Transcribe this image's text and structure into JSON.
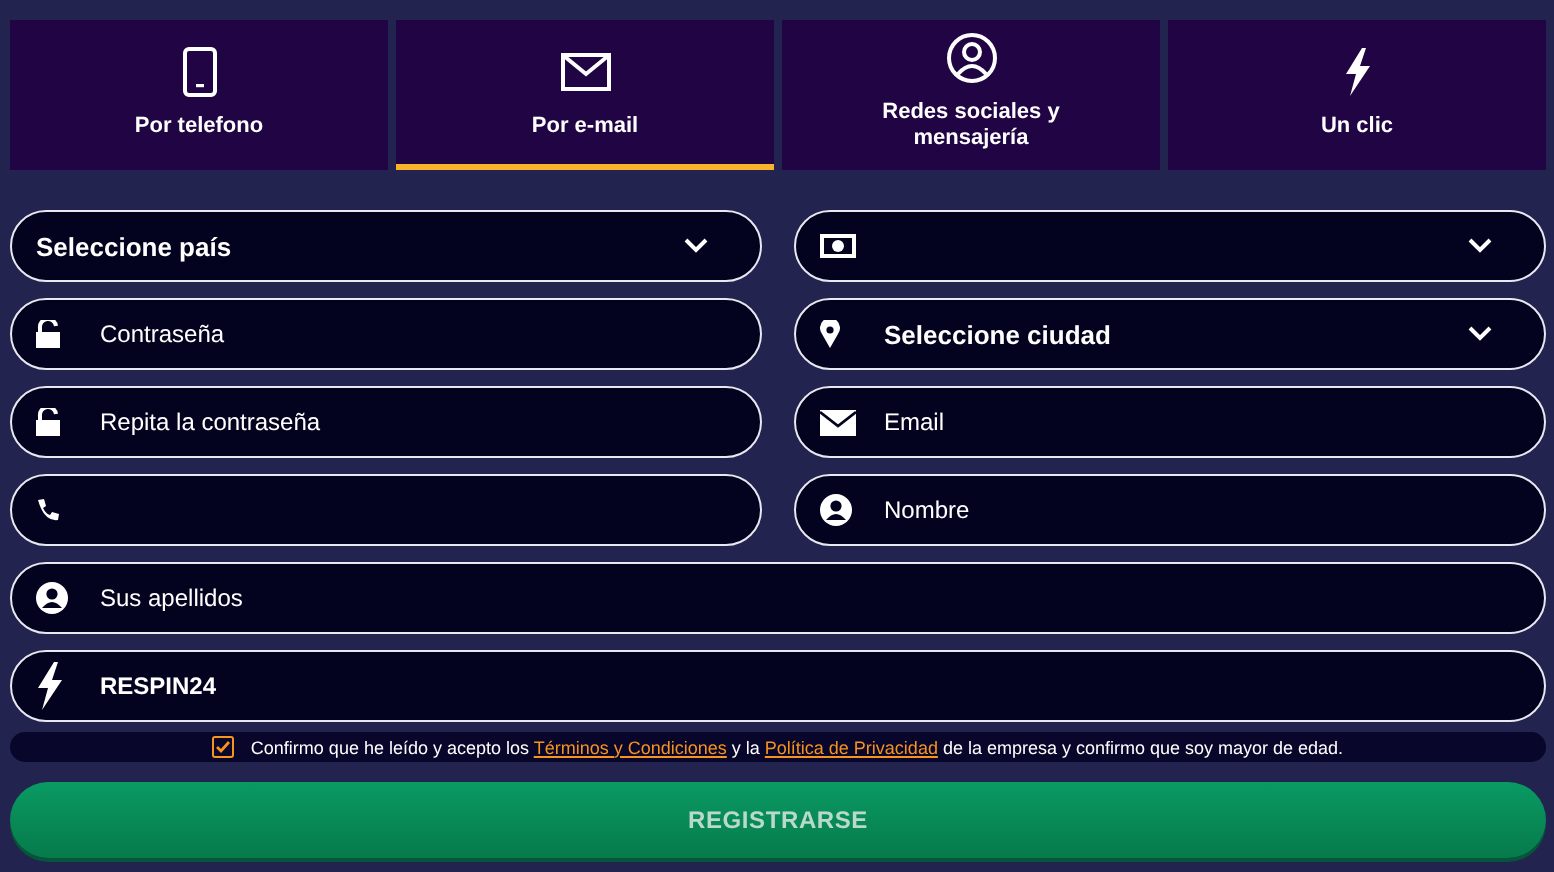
{
  "tabs": [
    {
      "label": "Por telefono",
      "selected": false
    },
    {
      "label": "Por e-mail",
      "selected": true
    },
    {
      "label": "Redes sociales y mensajería",
      "selected": false
    },
    {
      "label": "Un clic",
      "selected": false
    }
  ],
  "fields": [
    {
      "kind": "select",
      "value": "Seleccione país"
    },
    {
      "kind": "select"
    },
    {
      "kind": "input",
      "placeholder": "Contraseña"
    },
    {
      "kind": "select",
      "value": "Seleccione ciudad"
    },
    {
      "kind": "input",
      "placeholder": "Repita la contraseña"
    },
    {
      "kind": "input",
      "placeholder": "Email"
    },
    {
      "kind": "input"
    },
    {
      "kind": "input",
      "placeholder": "Nombre"
    },
    {
      "kind": "input",
      "placeholder": "Sus apellidos"
    },
    {
      "kind": "input",
      "value": "RESPIN24"
    }
  ],
  "consent": {
    "checked": true,
    "parts": [
      {
        "kind": "text",
        "text": "Confirmo que he leído y acepto los "
      },
      {
        "kind": "link",
        "text": "Términos y Condiciones"
      },
      {
        "kind": "text",
        "text": " y la "
      },
      {
        "kind": "link",
        "text": "Política de Privacidad"
      },
      {
        "kind": "text",
        "text": " de la empresa y confirmo que soy mayor de edad."
      }
    ]
  },
  "submit": {
    "label": "REGISTRARSE"
  }
}
